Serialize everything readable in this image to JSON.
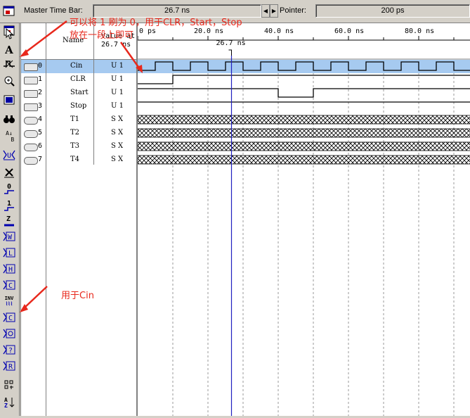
{
  "topbar": {
    "master_label": "Master Time Bar:",
    "master_value": "26.7 ns",
    "pointer_label": "Pointer:",
    "pointer_value": "200 ps"
  },
  "signal_panel": {
    "name_header": "Name",
    "value_header": "Value at",
    "value_time": "26.7 ns"
  },
  "signals": [
    {
      "index": "0",
      "name": "Cin",
      "value": "U 1",
      "type": "input"
    },
    {
      "index": "1",
      "name": "CLR",
      "value": "U 1",
      "type": "input"
    },
    {
      "index": "2",
      "name": "Start",
      "value": "U 1",
      "type": "input"
    },
    {
      "index": "3",
      "name": "Stop",
      "value": "U 1",
      "type": "input"
    },
    {
      "index": "4",
      "name": "T1",
      "value": "S X",
      "type": "output"
    },
    {
      "index": "5",
      "name": "T2",
      "value": "S X",
      "type": "output"
    },
    {
      "index": "6",
      "name": "T3",
      "value": "S X",
      "type": "output"
    },
    {
      "index": "7",
      "name": "T4",
      "value": "S X",
      "type": "output"
    }
  ],
  "timeline": {
    "ticks": [
      "0 ps",
      "20.0 ns",
      "40.0 ns",
      "60.0 ns",
      "80.0 ns"
    ],
    "cursor_label": "26.7 ns"
  },
  "annotations": {
    "top_line1": "可以将 1 刷为 0，用于CLR，Start，Stop",
    "top_line2": "放在一段上即可",
    "cin_note": "用于Cin"
  },
  "toolbar_icons": [
    "window-icon",
    "pointer-icon",
    "text-tool-icon",
    "waveform-edit-icon",
    "zoom-icon",
    "fit-window-icon",
    "find-icon",
    "replace-icon",
    "invert-icon",
    "force-low-icon",
    "force-high-icon",
    "high-impedance-icon",
    "weak-unknown-icon",
    "weak-low-icon",
    "weak-high-icon",
    "invert-value-icon",
    "count-value-icon",
    "clock-icon",
    "random-icon",
    "arbitrary-value-icon",
    "overwrite-value-icon",
    "grid-snap-icon",
    "sort-icon"
  ],
  "colors": {
    "selection": "#a6caf0",
    "cursor": "#2020c0",
    "annotation": "#e8281c"
  }
}
